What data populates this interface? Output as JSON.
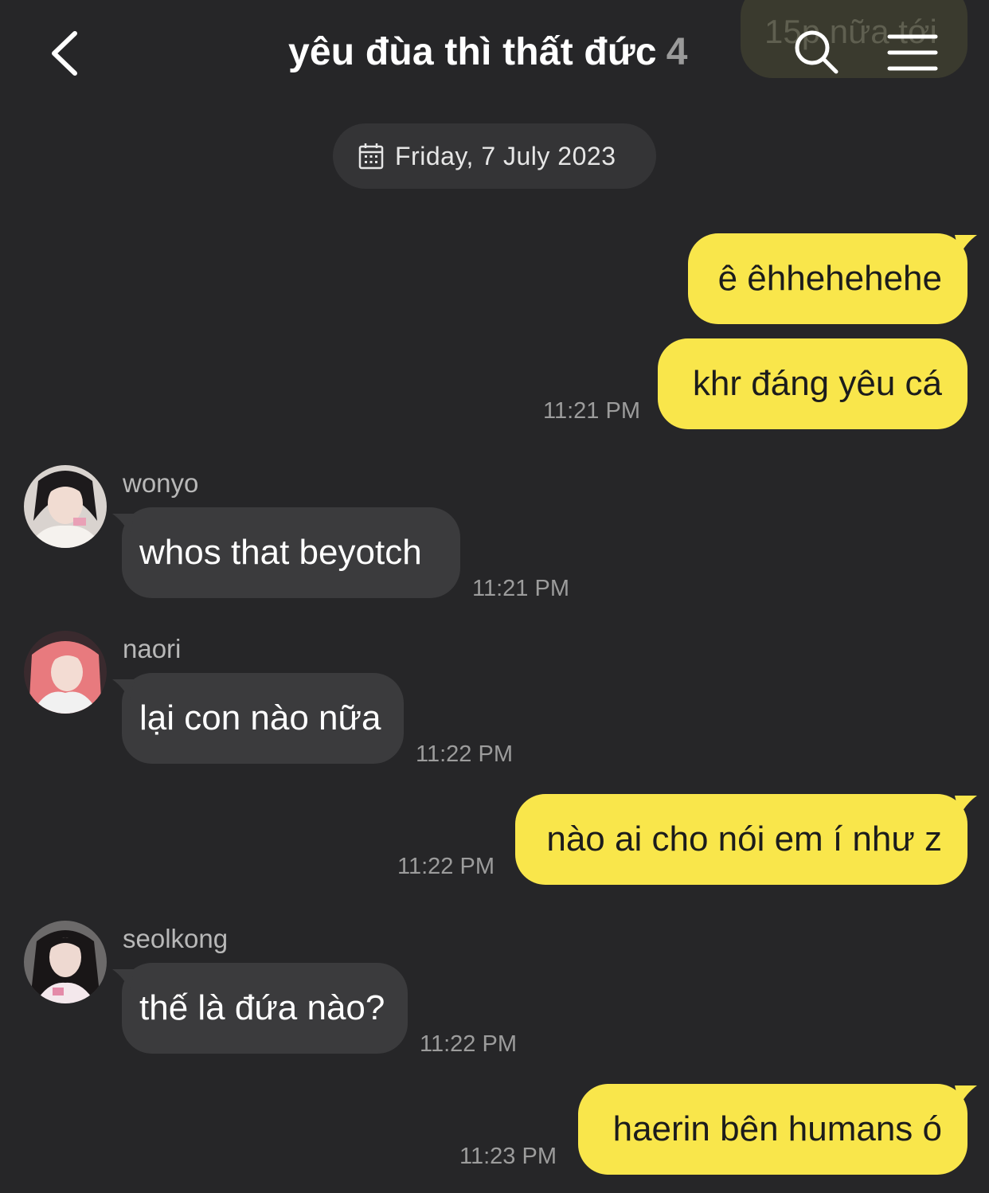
{
  "header": {
    "title": "yêu đùa thì thất đức",
    "member_count": "4",
    "back_icon": "chevron-left-icon",
    "search_icon": "search-icon",
    "menu_icon": "menu-icon"
  },
  "ghost_message": {
    "text": "15p nữa tới"
  },
  "date_divider": {
    "label": "Friday, 7 July 2023",
    "icon": "calendar-icon"
  },
  "messages": [
    {
      "direction": "out",
      "text": "ê êhhehehehe",
      "time": ""
    },
    {
      "direction": "out",
      "text": "khr đáng yêu cá",
      "time": "11:21 PM"
    },
    {
      "direction": "in",
      "sender": "wonyo",
      "text": "whos that beyotch",
      "time": "11:21 PM"
    },
    {
      "direction": "in",
      "sender": "naori",
      "text": "lại con nào nữa",
      "time": "11:22 PM"
    },
    {
      "direction": "out",
      "text": "nào ai cho nói em í như z",
      "time": "11:22 PM"
    },
    {
      "direction": "in",
      "sender": "seolkong",
      "text": "thế là đứa nào?",
      "time": "11:22 PM"
    },
    {
      "direction": "out",
      "text": "haerin bên humans ó",
      "time": "11:23 PM"
    }
  ],
  "colors": {
    "background": "#262628",
    "outgoing_bubble": "#f9e64b",
    "incoming_bubble": "#3b3b3d",
    "date_pill": "#343436"
  }
}
